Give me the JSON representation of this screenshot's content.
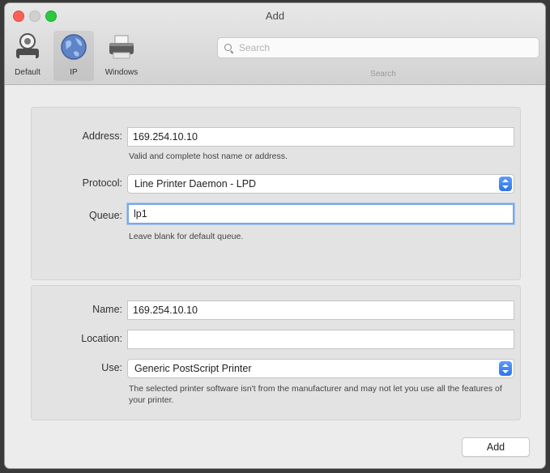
{
  "window": {
    "title": "Add"
  },
  "toolbar": {
    "items": [
      {
        "label": "Default",
        "icon": "default-printer-icon"
      },
      {
        "label": "IP",
        "icon": "globe-icon",
        "selected": true
      },
      {
        "label": "Windows",
        "icon": "windows-printer-icon"
      }
    ],
    "search_placeholder": "Search",
    "search_caption": "Search"
  },
  "connection": {
    "address_label": "Address:",
    "address_value": "169.254.10.10",
    "address_hint": "Valid and complete host name or address.",
    "protocol_label": "Protocol:",
    "protocol_value": "Line Printer Daemon - LPD",
    "queue_label": "Queue:",
    "queue_value": "lp1",
    "queue_hint": "Leave blank for default queue."
  },
  "details": {
    "name_label": "Name:",
    "name_value": "169.254.10.10",
    "location_label": "Location:",
    "location_value": "",
    "use_label": "Use:",
    "use_value": "Generic PostScript Printer",
    "use_hint": "The selected printer software isn't from the manufacturer and may not let you use all the features of your printer."
  },
  "actions": {
    "add_label": "Add"
  },
  "colors": {
    "accent": "#2f74ea",
    "close": "#fc5f57",
    "maximize": "#2ac940"
  }
}
